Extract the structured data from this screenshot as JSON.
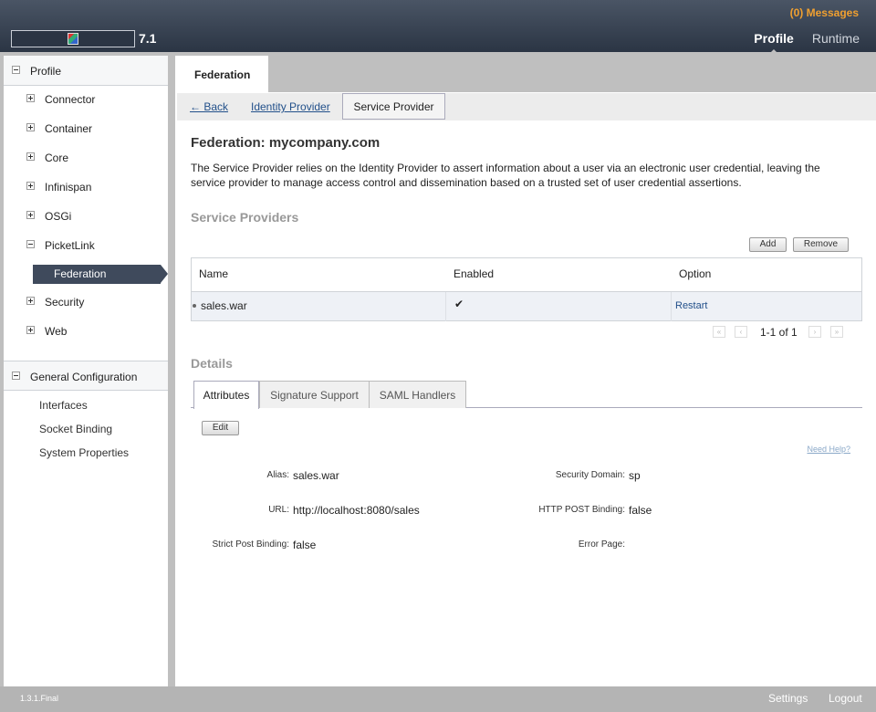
{
  "header": {
    "version": "7.1",
    "messages": "(0) Messages",
    "nav": [
      "Profile",
      "Runtime"
    ]
  },
  "sidebar": {
    "profile_label": "Profile",
    "items": [
      "Connector",
      "Container",
      "Core",
      "Infinispan",
      "OSGi",
      "PicketLink",
      "Security",
      "Web"
    ],
    "selected_child": "Federation",
    "general_label": "General Configuration",
    "general_items": [
      "Interfaces",
      "Socket Binding",
      "System Properties"
    ]
  },
  "main": {
    "page_tab": "Federation",
    "subnav": {
      "back": "← Back",
      "identity_provider": "Identity Provider",
      "service_provider": "Service Provider"
    },
    "title": "Federation: mycompany.com",
    "description": "The Service Provider relies on the Identity Provider to assert information about a user via an electronic user credential, leaving the service provider to manage access control and dissemination based on a trusted set of user credential assertions.",
    "providers_heading": "Service Providers",
    "add_label": "Add",
    "remove_label": "Remove",
    "columns": [
      "Name",
      "Enabled",
      "Option"
    ],
    "rows": [
      {
        "name": "sales.war",
        "enabled": "✔",
        "option": "Restart"
      }
    ],
    "pager": "1-1 of 1",
    "details_heading": "Details",
    "detail_tabs": [
      "Attributes",
      "Signature Support",
      "SAML Handlers"
    ],
    "edit_label": "Edit",
    "need_help": "Need Help?",
    "fields": {
      "alias_label": "Alias:",
      "alias": "sales.war",
      "security_domain_label": "Security Domain:",
      "security_domain": "sp",
      "url_label": "URL:",
      "url": "http://localhost:8080/sales",
      "http_post_label": "HTTP POST Binding:",
      "http_post": "false",
      "strict_post_label": "Strict Post Binding:",
      "strict_post": "false",
      "error_page_label": "Error Page:",
      "error_page": ""
    }
  },
  "footer": {
    "version": "1.3.1.Final",
    "settings": "Settings",
    "logout": "Logout"
  }
}
